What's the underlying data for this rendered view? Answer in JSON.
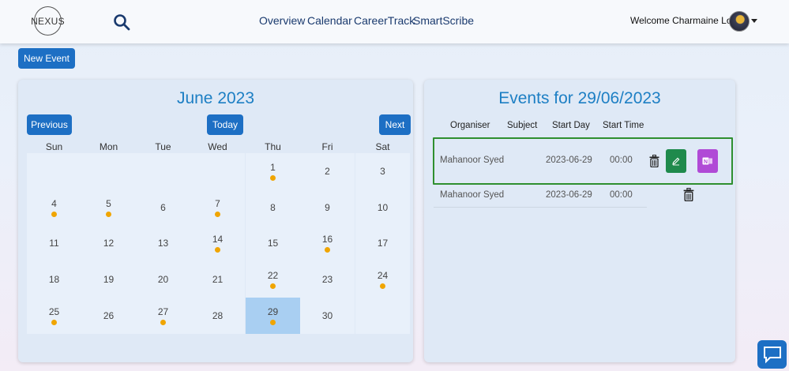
{
  "header": {
    "logo_text": "NEXUS",
    "nav": [
      "Overview",
      "Calendar",
      "CareerTrack",
      "SmartScribe"
    ],
    "welcome": "Welcome Charmaine Louie!"
  },
  "new_event_label": "New Event",
  "calendar": {
    "title": "June 2023",
    "prev_label": "Previous",
    "today_label": "Today",
    "next_label": "Next",
    "weekdays": [
      "Sun",
      "Mon",
      "Tue",
      "Wed",
      "Thu",
      "Fri",
      "Sat"
    ],
    "weeks": [
      [
        null,
        null,
        null,
        null,
        {
          "d": "1",
          "dot": true
        },
        {
          "d": "2"
        },
        {
          "d": "3"
        }
      ],
      [
        {
          "d": "4",
          "dot": true
        },
        {
          "d": "5",
          "dot": true
        },
        {
          "d": "6"
        },
        {
          "d": "7",
          "dot": true
        },
        {
          "d": "8"
        },
        {
          "d": "9"
        },
        {
          "d": "10"
        }
      ],
      [
        {
          "d": "11"
        },
        {
          "d": "12"
        },
        {
          "d": "13"
        },
        {
          "d": "14",
          "dot": true
        },
        {
          "d": "15"
        },
        {
          "d": "16",
          "dot": true
        },
        {
          "d": "17"
        }
      ],
      [
        {
          "d": "18"
        },
        {
          "d": "19"
        },
        {
          "d": "20"
        },
        {
          "d": "21"
        },
        {
          "d": "22",
          "dot": true
        },
        {
          "d": "23"
        },
        {
          "d": "24",
          "dot": true
        }
      ],
      [
        {
          "d": "25",
          "dot": true
        },
        {
          "d": "26"
        },
        {
          "d": "27",
          "dot": true
        },
        {
          "d": "28"
        },
        {
          "d": "29",
          "dot": true,
          "selected": true
        },
        {
          "d": "30"
        },
        null
      ]
    ]
  },
  "events": {
    "title": "Events for 29/06/2023",
    "columns": [
      "Organiser",
      "Subject",
      "Start Day",
      "Start Time"
    ],
    "rows": [
      {
        "organiser": "Mahanoor Syed",
        "subject": "",
        "start_day": "2023-06-29",
        "start_time": "00:00"
      },
      {
        "organiser": "Mahanoor Syed",
        "subject": "",
        "start_day": "2023-06-29",
        "start_time": "00:00"
      }
    ]
  },
  "colors": {
    "primary": "#1d6fc4",
    "accent_title": "#1d7fc4",
    "event_dot": "#f0a500",
    "selected_day": "#a9cff2",
    "edit_button": "#1f8a4c",
    "onenote_button": "#b04ad6",
    "selected_row_border": "#2f8f2f"
  },
  "icons": [
    "search-icon",
    "trash-icon",
    "edit-pencil-icon",
    "onenote-icon",
    "chat-icon",
    "chevron-down-icon"
  ]
}
